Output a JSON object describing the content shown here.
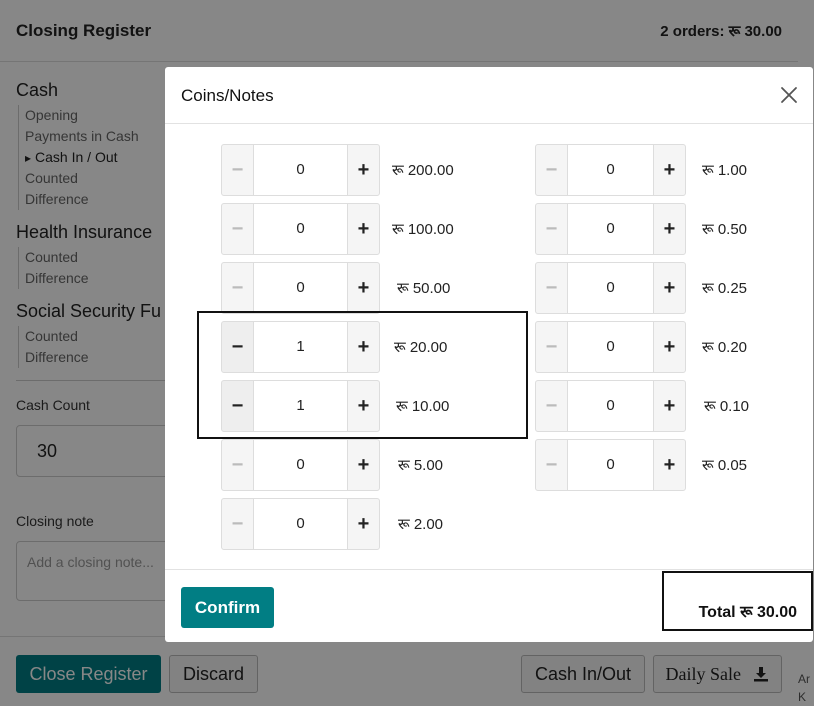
{
  "background": {
    "title": "Closing Register",
    "orders_summary": "2 orders: रू 30.00",
    "sections": [
      {
        "title": "Cash",
        "items": [
          "Opening",
          "Payments in Cash",
          "Cash In / Out",
          "Counted",
          "Difference"
        ]
      },
      {
        "title": "Health Insurance",
        "items": [
          "Counted",
          "Difference"
        ]
      },
      {
        "title": "Social Security Fu",
        "items": [
          "Counted",
          "Difference"
        ]
      }
    ],
    "cash_count_label": "Cash Count",
    "cash_count_value": "30",
    "closing_note_label": "Closing note",
    "closing_note_placeholder": "Add a closing note...",
    "footer": {
      "close_register": "Close Register",
      "discard": "Discard",
      "cash_in_out": "Cash In/Out",
      "daily_sale": "Daily  Sale"
    },
    "edge_text": [
      "Ar",
      "K"
    ]
  },
  "modal": {
    "title": "Coins/Notes",
    "left_column": [
      {
        "qty": "0",
        "label": "रू 200.00"
      },
      {
        "qty": "0",
        "label": "रू 100.00"
      },
      {
        "qty": "0",
        "label": "रू 50.00"
      },
      {
        "qty": "1",
        "label": "रू 20.00"
      },
      {
        "qty": "1",
        "label": "रू 10.00"
      },
      {
        "qty": "0",
        "label": "रू 5.00"
      },
      {
        "qty": "0",
        "label": "रू 2.00"
      }
    ],
    "right_column": [
      {
        "qty": "0",
        "label": "रू 1.00"
      },
      {
        "qty": "0",
        "label": "रू 0.50"
      },
      {
        "qty": "0",
        "label": "रू 0.25"
      },
      {
        "qty": "0",
        "label": "रू 0.20"
      },
      {
        "qty": "0",
        "label": "रू 0.10"
      },
      {
        "qty": "0",
        "label": "रू 0.05"
      }
    ],
    "confirm_label": "Confirm",
    "total_label": "Total रू 30.00"
  },
  "colors": {
    "accent": "#017e84"
  },
  "icons": {
    "close": "close-icon",
    "download": "download-icon",
    "minus": "minus-icon",
    "plus": "plus-icon"
  }
}
